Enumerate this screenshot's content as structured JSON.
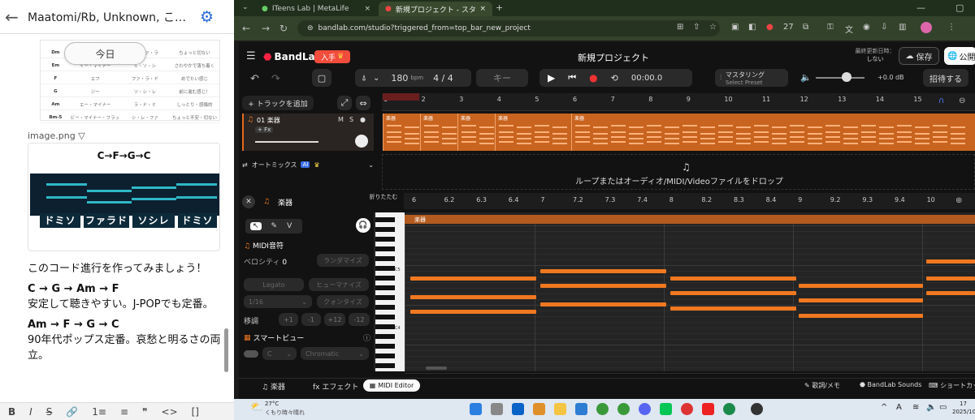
{
  "left_panel": {
    "title": "Maatomi/Rb, Unknown, こ…",
    "today_label": "今日",
    "chord_rows": [
      [
        "Dm",
        "ディー・マイナー",
        "レ・ファ・ラ",
        "ちょっと切ない"
      ],
      [
        "Em",
        "イー・マイナー",
        "ミ・ソ・シ",
        "さわやかで落ち着く"
      ],
      [
        "F",
        "エフ",
        "ファ・ラ・ド",
        "めでたい感じ"
      ],
      [
        "G",
        "ジー",
        "ソ・シ・レ",
        "前に進む感じ！"
      ],
      [
        "Am",
        "エー・マイナー",
        "ラ・ド・ミ",
        "しっとり・感傷的"
      ],
      [
        "Bm-5",
        "ビー・マイナー・フラット・ファイブ",
        "シ・レ・ファ",
        "ちょっと不安・切ない"
      ]
    ],
    "image_name": "image.png",
    "image_progression": "C→F→G→C",
    "image_syllables": [
      "ドミソ",
      "ファラド",
      "ソシレ",
      "ドミソ"
    ],
    "paragraphs": [
      {
        "text": "このコード進行を作ってみましょう！",
        "bold": false
      },
      {
        "text": "C → G → Am → F",
        "bold": true
      },
      {
        "text": "安定して聴きやすい。J-POPでも定番。",
        "bold": false
      },
      {
        "text": "Am → F → G → C",
        "bold": true
      },
      {
        "text": "90年代ポップス定番。哀愁と明るさの両立。",
        "bold": false
      }
    ],
    "toolbar": [
      "B",
      "I",
      "S",
      "🔗",
      "1≡",
      "≡",
      "❞",
      "<>",
      "[]"
    ]
  },
  "browser": {
    "tabs": [
      {
        "label": "ITeens Lab | MetaLife"
      },
      {
        "label": "新規プロジェクト - スタジオ"
      }
    ],
    "url": "bandlab.com/studio?triggered_from=top_bar_new_project",
    "badge_count": "27"
  },
  "bandlab": {
    "brand": "BandLab",
    "buy_label": "入手",
    "project_title": "新規プロジェクト",
    "last_updated_label": "最終更新日時：",
    "last_updated_value": "しない",
    "save_label": "保存",
    "publish_label": "公開",
    "tempo": "180",
    "tempo_unit": "bpm",
    "time_signature": "4 / 4",
    "key_label": "キー",
    "time": "00:00.0",
    "mastering_label": "マスタリング",
    "mastering_sub": "Select Preset",
    "gain": "+0.0 dB",
    "invite_label": "招待する",
    "add_track_label": "+ トラックを追加",
    "track_name": "01 楽器",
    "fx_label": "+ Fx",
    "automix_label": "オートミックス",
    "drop_text": "ループまたはオーディオ/MIDI/Videoファイルをドロップ",
    "ruler_numbers": [
      "1",
      "2",
      "3",
      "4",
      "5",
      "6",
      "7",
      "8",
      "9",
      "10",
      "11",
      "12",
      "13",
      "14",
      "15"
    ],
    "clip_label": "楽器",
    "editor_title": "楽器",
    "fold_label": "折りたたむ",
    "midi_ruler": [
      "6",
      "6.2",
      "6.3",
      "6.4",
      "7",
      "7.2",
      "7.3",
      "7.4",
      "8",
      "8.2",
      "8.3",
      "8.4",
      "9",
      "9.2",
      "9.3",
      "9.4",
      "10"
    ],
    "midi_section": "MIDI音符",
    "velocity_label": "ベロシティ",
    "velocity_value": "0",
    "randomize_label": "ランダマイズ",
    "legato_label": "Legato",
    "humanize_label": "ヒューマナイズ",
    "grid_value": "1/16",
    "quantize_label": "クォンタイズ",
    "transpose_label": "移調",
    "transpose_values": [
      "+1",
      "-1",
      "+12",
      "-12"
    ],
    "smart_view_label": "スマートビュー",
    "scale_root": "C",
    "scale_type": "Chromatic",
    "c5_label": "C5",
    "c4_label": "C4",
    "bottom_tabs": [
      "楽器",
      "エフェクト",
      "MIDI Editor"
    ],
    "bottom_right": [
      "歌詞/メモ",
      "BandLab Sounds",
      "ショートカット"
    ]
  },
  "taskbar": {
    "temperature": "27°C",
    "weather": "くもり時々晴れ",
    "time": "17",
    "date": "2025/10"
  }
}
